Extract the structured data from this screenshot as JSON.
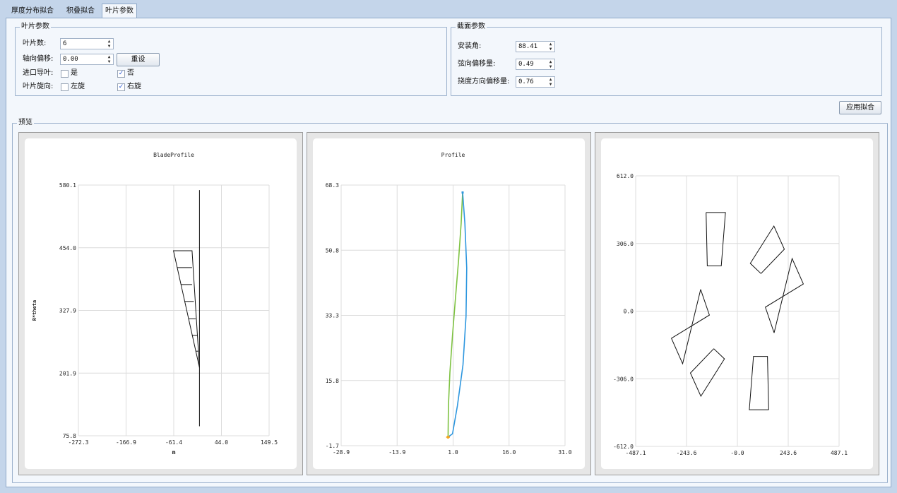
{
  "tabs": [
    {
      "label": "厚度分布拟合",
      "active": false
    },
    {
      "label": "积叠拟合",
      "active": false
    },
    {
      "label": "叶片参数",
      "active": true
    }
  ],
  "blade_params": {
    "title": "叶片参数",
    "count_label": "叶片数:",
    "count_value": "6",
    "axial_offset_label": "轴向偏移:",
    "axial_offset_value": "0.00",
    "reset_label": "重设",
    "inlet_guide_label": "进口导叶:",
    "inlet_yes": "是",
    "inlet_yes_checked": false,
    "inlet_no": "否",
    "inlet_no_checked": true,
    "rotation_label": "叶片旋向:",
    "rot_left": "左旋",
    "rot_left_checked": false,
    "rot_right": "右旋",
    "rot_right_checked": true
  },
  "section_params": {
    "title": "截面参数",
    "install_angle_label": "安装角:",
    "install_angle_value": "88.41",
    "chord_offset_label": "弦向偏移量:",
    "chord_offset_value": "0.49",
    "deflection_offset_label": "挠度方向偏移量:",
    "deflection_offset_value": "0.76"
  },
  "apply_label": "应用拟合",
  "preview_title": "预览",
  "colors": {
    "accent_green": "#7ec242",
    "accent_blue": "#2e97df",
    "accent_orange": "#f5a623",
    "line": "#111111"
  },
  "chart_data": [
    {
      "type": "line",
      "title": "BladeProfile",
      "xlabel": "m",
      "ylabel": "R*theta",
      "xlim": [
        -272.3,
        149.5
      ],
      "ylim": [
        75.8,
        580.1
      ],
      "x_ticks": [
        "-272.3",
        "-166.9",
        "-61.4",
        "44.0",
        "149.5"
      ],
      "y_ticks": [
        "75.8",
        "201.9",
        "327.9",
        "454.0",
        "580.1"
      ],
      "grid": true,
      "series": [
        {
          "values": [
            [
              -4.5,
              570.0
            ],
            [
              -4.5,
              95.0
            ]
          ]
        },
        {
          "values": [
            [
              -4.5,
              213.0
            ],
            [
              -62.0,
              448.0
            ],
            [
              -21.0,
              448.0
            ],
            [
              -4.5,
              213.0
            ]
          ]
        },
        {
          "values": [
            [
              -54.0,
              414.0
            ],
            [
              -21.0,
              414.0
            ]
          ]
        },
        {
          "values": [
            [
              -46.0,
              380.0
            ],
            [
              -21.0,
              380.0
            ]
          ]
        },
        {
          "values": [
            [
              -38.0,
              346.0
            ],
            [
              -17.0,
              346.0
            ]
          ]
        },
        {
          "values": [
            [
              -29.0,
              311.0
            ],
            [
              -13.0,
              311.0
            ]
          ]
        },
        {
          "values": [
            [
              -21.0,
              278.0
            ],
            [
              -9.0,
              278.0
            ]
          ]
        },
        {
          "values": [
            [
              -13.0,
              246.0
            ],
            [
              -6.0,
              246.0
            ]
          ]
        }
      ]
    },
    {
      "type": "line",
      "title": "Profile",
      "xlim": [
        -28.9,
        31.0
      ],
      "ylim": [
        -1.7,
        68.3
      ],
      "x_ticks": [
        "-28.9",
        "-13.9",
        "1.0",
        "16.0",
        "31.0"
      ],
      "y_ticks": [
        "-1.7",
        "15.8",
        "33.3",
        "50.8",
        "68.3"
      ],
      "grid": true,
      "series": [
        {
          "values": [
            [
              -0.3,
              0.6
            ],
            [
              -0.2,
              9.0
            ],
            [
              0.2,
              18.0
            ],
            [
              0.9,
              28.0
            ],
            [
              1.7,
              38.0
            ],
            [
              2.5,
              48.0
            ],
            [
              3.2,
              58.0
            ],
            [
              3.6,
              66.3
            ]
          ]
        },
        {
          "values": [
            [
              -0.3,
              0.6
            ],
            [
              0.9,
              1.5
            ],
            [
              2.2,
              9.0
            ],
            [
              3.7,
              20.0
            ],
            [
              4.5,
              33.0
            ],
            [
              4.7,
              46.0
            ],
            [
              4.2,
              58.0
            ],
            [
              3.6,
              66.3
            ]
          ]
        },
        {
          "values": [
            [
              -0.8,
              0.6
            ],
            [
              0.2,
              0.6
            ]
          ]
        }
      ]
    },
    {
      "type": "line",
      "xlim": [
        -487.1,
        487.1
      ],
      "ylim": [
        -612.0,
        612.0
      ],
      "x_ticks": [
        "-487.1",
        "-243.6",
        "-0.0",
        "243.6",
        "487.1"
      ],
      "y_ticks": [
        "-612.0",
        "-306.0",
        "0.0",
        "306.0",
        "612.0"
      ],
      "grid": true,
      "series": [
        {
          "values": [
            [
              -150,
              446
            ],
            [
              -57,
              446
            ],
            [
              -77,
              205
            ],
            [
              -144,
              205
            ],
            [
              -150,
              446
            ]
          ]
        },
        {
          "values": [
            [
              113,
              170
            ],
            [
              62,
              216
            ],
            [
              175,
              385
            ],
            [
              225,
              280
            ],
            [
              113,
              170
            ]
          ]
        },
        {
          "values": [
            [
              176,
              -98
            ],
            [
              134,
              18
            ],
            [
              316,
              123
            ],
            [
              262,
              238
            ],
            [
              176,
              -98
            ]
          ]
        },
        {
          "values": [
            [
              150,
              -446
            ],
            [
              57,
              -446
            ],
            [
              77,
              -205
            ],
            [
              144,
              -205
            ],
            [
              150,
              -446
            ]
          ]
        },
        {
          "values": [
            [
              -113,
              -170
            ],
            [
              -62,
              -216
            ],
            [
              -175,
              -385
            ],
            [
              -225,
              -280
            ],
            [
              -113,
              -170
            ]
          ]
        },
        {
          "values": [
            [
              -176,
              98
            ],
            [
              -134,
              -18
            ],
            [
              -316,
              -123
            ],
            [
              -262,
              -238
            ],
            [
              -176,
              98
            ]
          ]
        }
      ]
    }
  ]
}
